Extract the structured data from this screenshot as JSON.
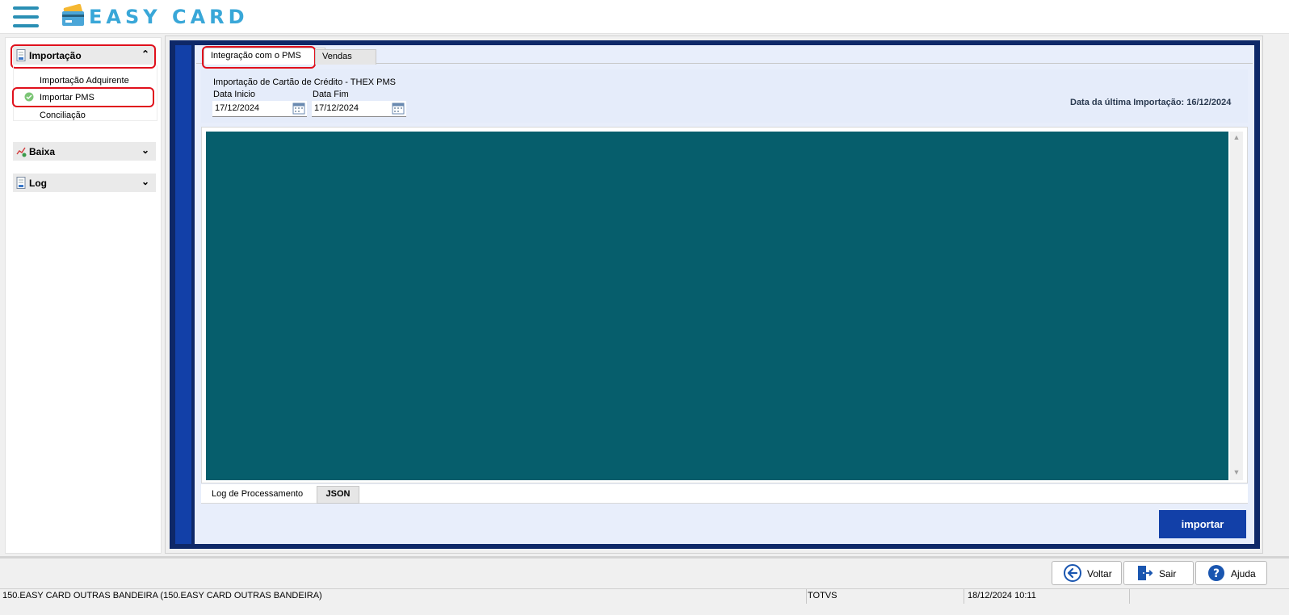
{
  "app": {
    "brand": "EASY CARD"
  },
  "sidebar": {
    "sections": [
      {
        "label": "Importação",
        "chevron": "⌃",
        "expanded": true
      },
      {
        "label": "Baixa",
        "chevron": "⌄",
        "expanded": false
      },
      {
        "label": "Log",
        "chevron": "⌄",
        "expanded": false
      }
    ],
    "importacao_items": [
      {
        "label": "Importação Adquirente"
      },
      {
        "label": "Importar PMS",
        "selected": true
      },
      {
        "label": "Conciliação"
      }
    ]
  },
  "tabs": [
    {
      "label": "Integração com o PMS",
      "active": true
    },
    {
      "label": "Vendas",
      "active": false
    }
  ],
  "form": {
    "title": "Importação de Cartão de Crédito - THEX PMS",
    "data_inicio_label": "Data Inicio",
    "data_inicio_value": "17/12/2024",
    "data_fim_label": "Data Fim",
    "data_fim_value": "17/12/2024",
    "last_import": "Data da última Importação: 16/12/2024"
  },
  "bottom_tabs": [
    {
      "label": "Log de Processamento",
      "active": true
    },
    {
      "label": "JSON",
      "active": false
    }
  ],
  "importar_label": "importar",
  "actions": [
    {
      "label": "Voltar",
      "icon": "back-icon"
    },
    {
      "label": "Sair",
      "icon": "exit-icon"
    },
    {
      "label": "Ajuda",
      "icon": "help-icon"
    }
  ],
  "status": {
    "company": "150.EASY CARD OUTRAS BANDEIRA (150.EASY CARD OUTRAS BANDEIRA)",
    "vendor": "TOTVS",
    "datetime": "18/12/2024 10:11"
  },
  "colors": {
    "navy": "#0e2868",
    "accent_blue": "#1240a8",
    "teal": "#065e6c",
    "highlight_red": "#e0101c",
    "brand": "#39a7d8"
  }
}
